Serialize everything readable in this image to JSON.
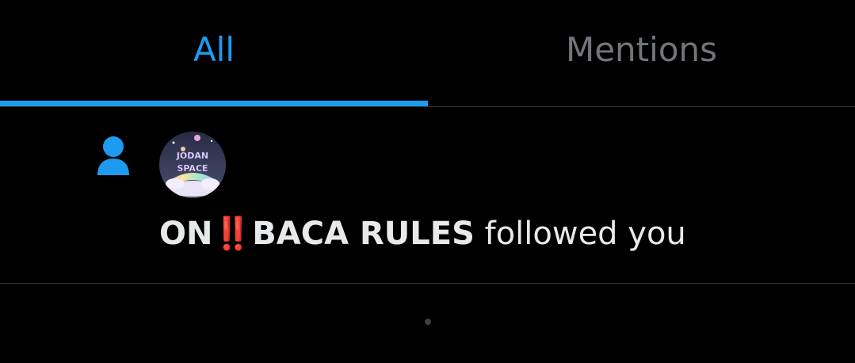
{
  "tabs": {
    "all_label": "All",
    "mentions_label": "Mentions"
  },
  "notification": {
    "type_icon": "person-icon",
    "avatar_label": "JODAN SPACE",
    "user_name": "ON",
    "emoji": "‼️",
    "user_name_rest": "BACA RULES",
    "action_text": " followed you"
  },
  "colors": {
    "accent": "#1d9bf0",
    "inactive_tab": "#71767b",
    "text": "#e7e9ea",
    "divider": "#2f3336"
  }
}
